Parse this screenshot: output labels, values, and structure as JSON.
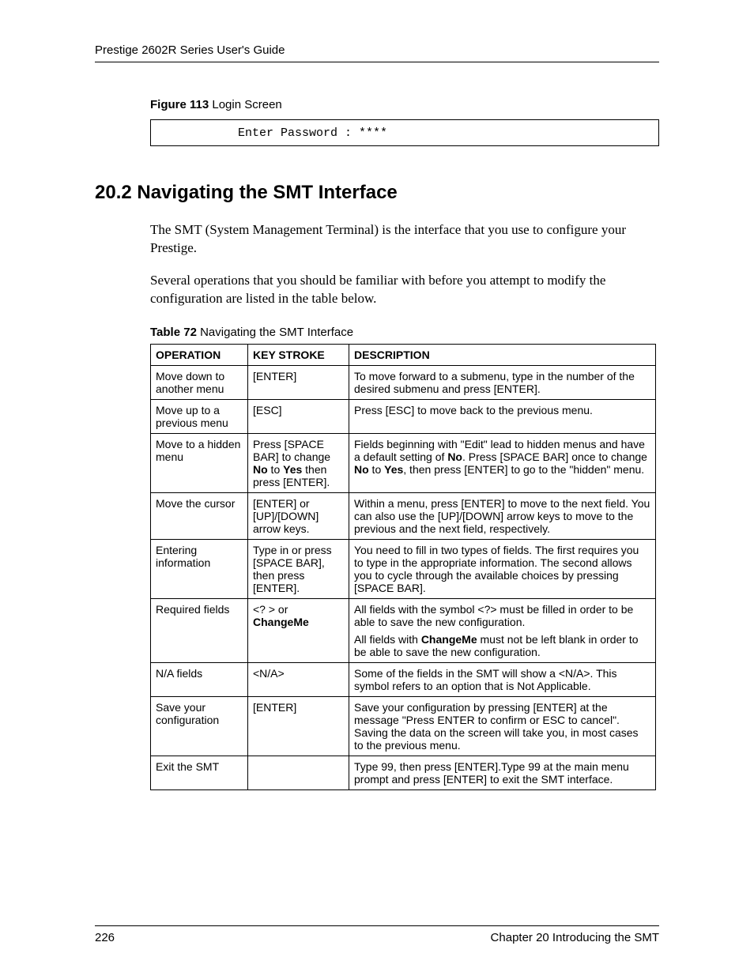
{
  "header": {
    "title": "Prestige 2602R Series User's Guide"
  },
  "figure": {
    "label_bold": "Figure 113",
    "label_rest": "   Login Screen",
    "content": "Enter Password : ****"
  },
  "section": {
    "heading": "20.2  Navigating the SMT Interface",
    "para1": "The SMT (System Management Terminal) is the interface that you use to configure your Prestige.",
    "para2": "Several operations that you should be familiar with before you attempt to modify the configuration are listed in the table below."
  },
  "table": {
    "caption_bold": "Table 72",
    "caption_rest": "   Navigating the SMT Interface",
    "headers": {
      "c0": "OPERATION",
      "c1": "KEY STROKE",
      "c2": "DESCRIPTION"
    },
    "rows": [
      {
        "op": "Move down to another menu",
        "key": "[ENTER]",
        "desc": [
          {
            "pre": "To move forward to a submenu, type in the number of the desired submenu and press [ENTER]."
          }
        ]
      },
      {
        "op": "Move up to a previous menu",
        "key": "[ESC]",
        "desc": [
          {
            "pre": "Press [ESC] to move back to the previous menu."
          }
        ]
      },
      {
        "op": "Move to a hidden menu",
        "key_segments": [
          {
            "t": "Press [SPACE BAR] to change "
          },
          {
            "t": "No",
            "b": true
          },
          {
            "t": " to "
          },
          {
            "t": "Yes",
            "b": true
          },
          {
            "t": " then press [ENTER]."
          }
        ],
        "desc": [
          {
            "segments": [
              {
                "t": "Fields beginning with \"Edit\" lead to hidden menus and have a default setting of "
              },
              {
                "t": "No",
                "b": true
              },
              {
                "t": ". Press [SPACE BAR] once to change "
              },
              {
                "t": "No",
                "b": true
              },
              {
                "t": " to "
              },
              {
                "t": "Yes",
                "b": true
              },
              {
                "t": ", then press [ENTER] to go to the  \"hidden\" menu."
              }
            ]
          }
        ]
      },
      {
        "op": "Move the cursor",
        "key": "[ENTER] or [UP]/[DOWN] arrow keys.",
        "desc": [
          {
            "pre": "Within a menu, press [ENTER] to move to the next field. You can also use the [UP]/[DOWN] arrow keys to move to the previous and the next field, respectively."
          }
        ]
      },
      {
        "op": "Entering information",
        "key": "Type in or press [SPACE BAR], then press [ENTER].",
        "desc": [
          {
            "pre": "You need to fill in two types of fields. The first requires you to type in the appropriate information. The second allows you to cycle through the available choices by pressing [SPACE BAR]."
          }
        ]
      },
      {
        "op": "Required fields",
        "key_segments": [
          {
            "t": "<? > or "
          },
          {
            "t": "ChangeMe",
            "b": true
          }
        ],
        "desc": [
          {
            "pre": "All fields with the symbol <?> must be filled in order to be able to save the new configuration."
          },
          {
            "segments": [
              {
                "t": "All fields with "
              },
              {
                "t": "ChangeMe",
                "b": true
              },
              {
                "t": " must not be left blank in order to be able to save the new configuration."
              }
            ]
          }
        ]
      },
      {
        "op": "N/A fields",
        "key": "<N/A>",
        "desc": [
          {
            "pre": "Some of the fields in the SMT will show a <N/A>. This symbol refers to an option that is Not Applicable."
          }
        ]
      },
      {
        "op": "Save your configuration",
        "key": "[ENTER]",
        "desc": [
          {
            "pre": "Save your configuration by pressing [ENTER] at the message \"Press ENTER to confirm or ESC to cancel\". Saving the data on the screen will take you, in most cases to the previous menu."
          }
        ]
      },
      {
        "op": "Exit the SMT",
        "key": "",
        "desc": [
          {
            "pre": "Type 99, then press [ENTER].Type 99 at the main menu prompt and press [ENTER] to exit the SMT interface."
          }
        ]
      }
    ]
  },
  "footer": {
    "page": "226",
    "chapter": "Chapter 20 Introducing the SMT"
  }
}
